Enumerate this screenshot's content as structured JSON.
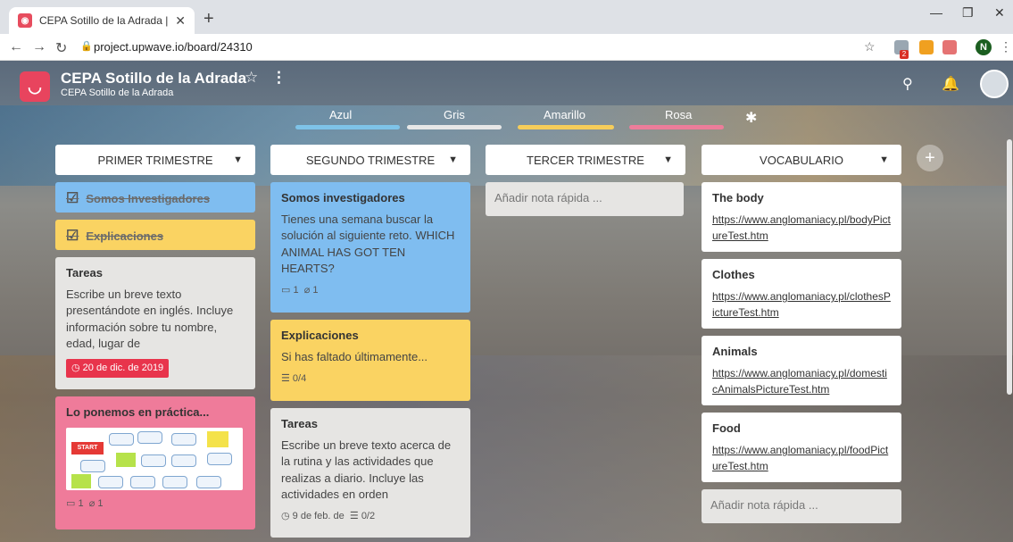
{
  "browser": {
    "tab_title": "CEPA Sotillo de la Adrada | Upwave",
    "url": "project.upwave.io/board/24310",
    "profile_initial": "N",
    "extension_badge": "2"
  },
  "board": {
    "title": "CEPA Sotillo de la Adrada",
    "subtitle": "CEPA Sotillo de la Adrada",
    "labels": [
      {
        "name": "Azul",
        "color": "#7ec3e8"
      },
      {
        "name": "Gris",
        "color": "#e7e7e7"
      },
      {
        "name": "Amarillo",
        "color": "#f6cd5a"
      },
      {
        "name": "Rosa",
        "color": "#ec7d9a"
      }
    ]
  },
  "columns": [
    {
      "title": "PRIMER TRIMESTRE",
      "cards": [
        {
          "title": "Somos Investigadores",
          "color": "blue",
          "done": true
        },
        {
          "title": "Explicaciones",
          "color": "yellow",
          "done": true
        },
        {
          "title": "Tareas",
          "color": "gray",
          "body": "Escribe un breve texto presentándote en inglés. Incluye información sobre tu nombre, edad, lugar de",
          "due": "20 de dic. de 2019"
        },
        {
          "title": "Lo ponemos en práctica...",
          "color": "pink",
          "comments": "1",
          "attachments": "1",
          "game_start": "START"
        }
      ]
    },
    {
      "title": "SEGUNDO TRIMESTRE",
      "cards": [
        {
          "title": "Somos investigadores",
          "color": "blue",
          "body": "Tienes una semana buscar la solución al siguiente reto. WHICH ANIMAL HAS GOT TEN HEARTS?",
          "comments": "1",
          "attachments": "1"
        },
        {
          "title": "Explicaciones",
          "color": "yellow",
          "body": "Si has faltado últimamente...",
          "checklist": "0/4"
        },
        {
          "title": "Tareas",
          "color": "gray",
          "body": "Escribe un breve texto acerca de la rutina y las actividades que realizas a diario. Incluye las actividades en orden",
          "due": "9 de feb. de",
          "checklist": "0/2"
        }
      ]
    },
    {
      "title": "TERCER TRIMESTRE",
      "quick_note": "Añadir nota rápida ..."
    },
    {
      "title": "VOCABULARIO",
      "cards": [
        {
          "title": "The body",
          "link": "https://www.anglomaniacy.pl/bodyPictureTest.htm"
        },
        {
          "title": "Clothes",
          "link": "https://www.anglomaniacy.pl/clothesPictureTest.htm"
        },
        {
          "title": "Animals",
          "link": "https://www.anglomaniacy.pl/domesticAnimalsPictureTest.htm"
        },
        {
          "title": "Food",
          "link": "https://www.anglomaniacy.pl/foodPictureTest.htm"
        }
      ],
      "quick_note": "Añadir nota rápida ..."
    }
  ]
}
